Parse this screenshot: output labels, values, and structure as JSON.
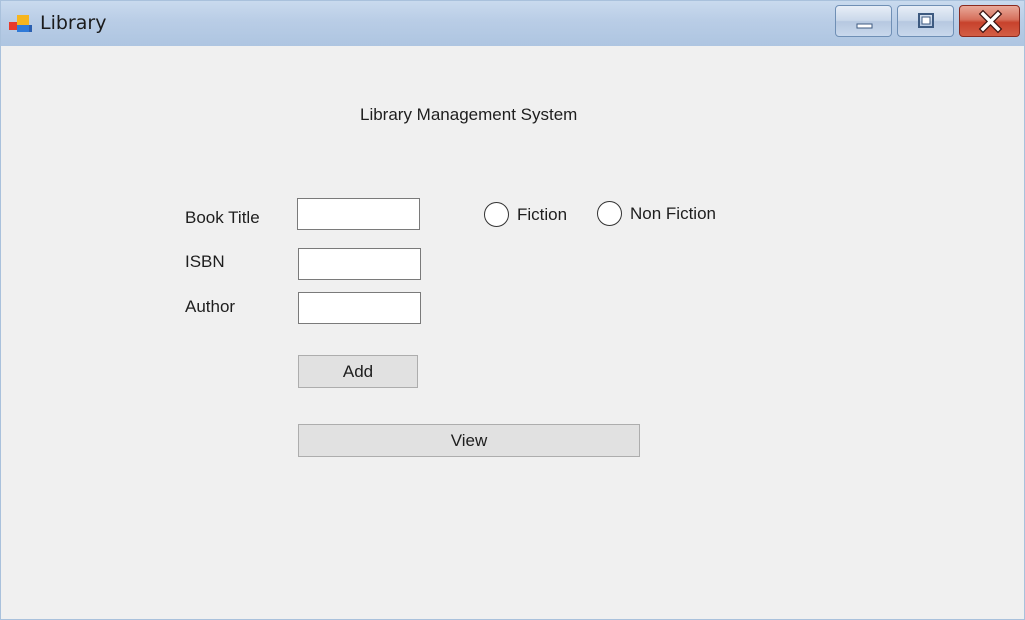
{
  "window": {
    "title": "Library"
  },
  "form": {
    "heading": "Library Management System",
    "book_title_label": "Book Title",
    "isbn_label": "ISBN",
    "author_label": "Author",
    "book_title_value": "",
    "isbn_value": "",
    "author_value": "",
    "genre_options": [
      "Fiction",
      "Non Fiction"
    ],
    "selected_genre": null,
    "add_button": "Add",
    "view_button": "View"
  },
  "icons": {
    "app": "library-app-icon",
    "minimize": "minimize-icon",
    "maximize": "maximize-icon",
    "close": "close-icon"
  },
  "colors": {
    "titlebar": "#b9cde6",
    "client_background": "#f0f0f0",
    "close_button": "#c7422c",
    "button_face": "#e1e1e1"
  }
}
